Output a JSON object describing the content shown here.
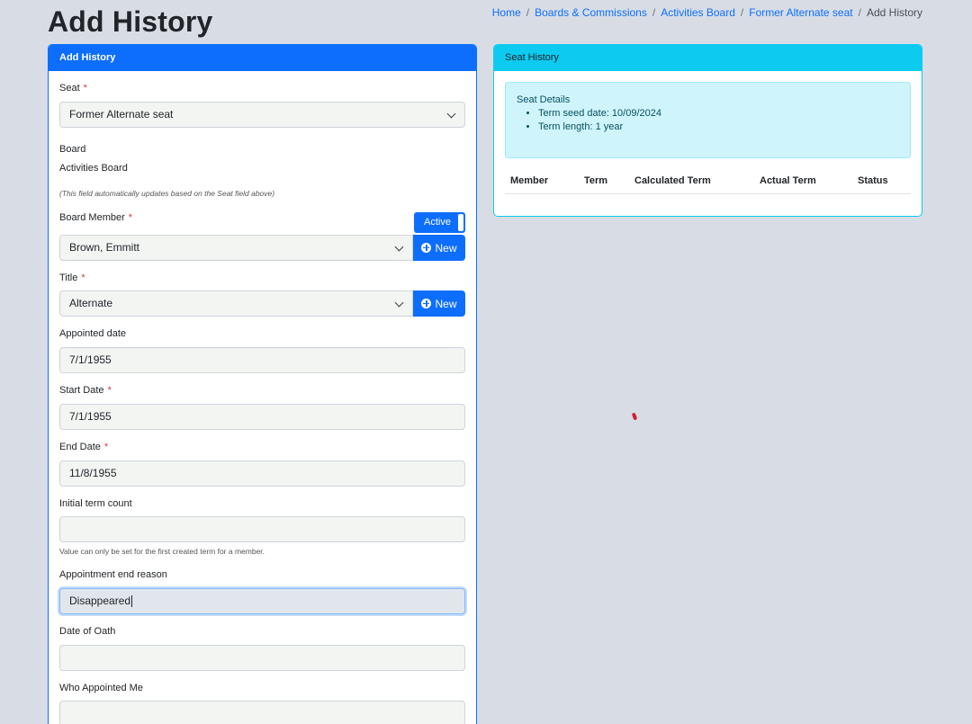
{
  "page": {
    "title": "Add History"
  },
  "breadcrumb": [
    "Home",
    "Boards & Commissions",
    "Activities Board",
    "Former Alternate seat",
    "Add History"
  ],
  "form_card": {
    "header": "Add History",
    "seat": {
      "label": "Seat",
      "value": "Former Alternate seat"
    },
    "board": {
      "label": "Board",
      "value": "Activities Board",
      "hint": "(This field automatically updates based on the Seat field above)"
    },
    "board_member": {
      "label": "Board Member",
      "value": "Brown, Emmitt",
      "toggle_label": "Active",
      "new_label": "New"
    },
    "title": {
      "label": "Title",
      "value": "Alternate",
      "new_label": "New"
    },
    "appointed_date": {
      "label": "Appointed date",
      "value": "7/1/1955"
    },
    "start_date": {
      "label": "Start Date",
      "value": "7/1/1955"
    },
    "end_date": {
      "label": "End Date",
      "value": "11/8/1955"
    },
    "initial_term_count": {
      "label": "Initial term count",
      "value": "",
      "hint": "Value can only be set for the first created term for a member."
    },
    "appointment_end_reason": {
      "label": "Appointment end reason",
      "value": "Disappeared"
    },
    "date_of_oath": {
      "label": "Date of Oath",
      "value": ""
    },
    "who_appointed_me": {
      "label": "Who Appointed Me",
      "value": ""
    },
    "required_mark": "*"
  },
  "history_card": {
    "header": "Seat History",
    "details_title": "Seat Details",
    "details": [
      "Term seed date: 10/09/2024",
      "Term length: 1 year"
    ],
    "columns": [
      "Member",
      "Term",
      "Calculated Term",
      "Actual Term",
      "Status"
    ]
  },
  "colors": {
    "primary": "#0d6efd",
    "info": "#0dcaf0",
    "required": "#dc3545"
  }
}
